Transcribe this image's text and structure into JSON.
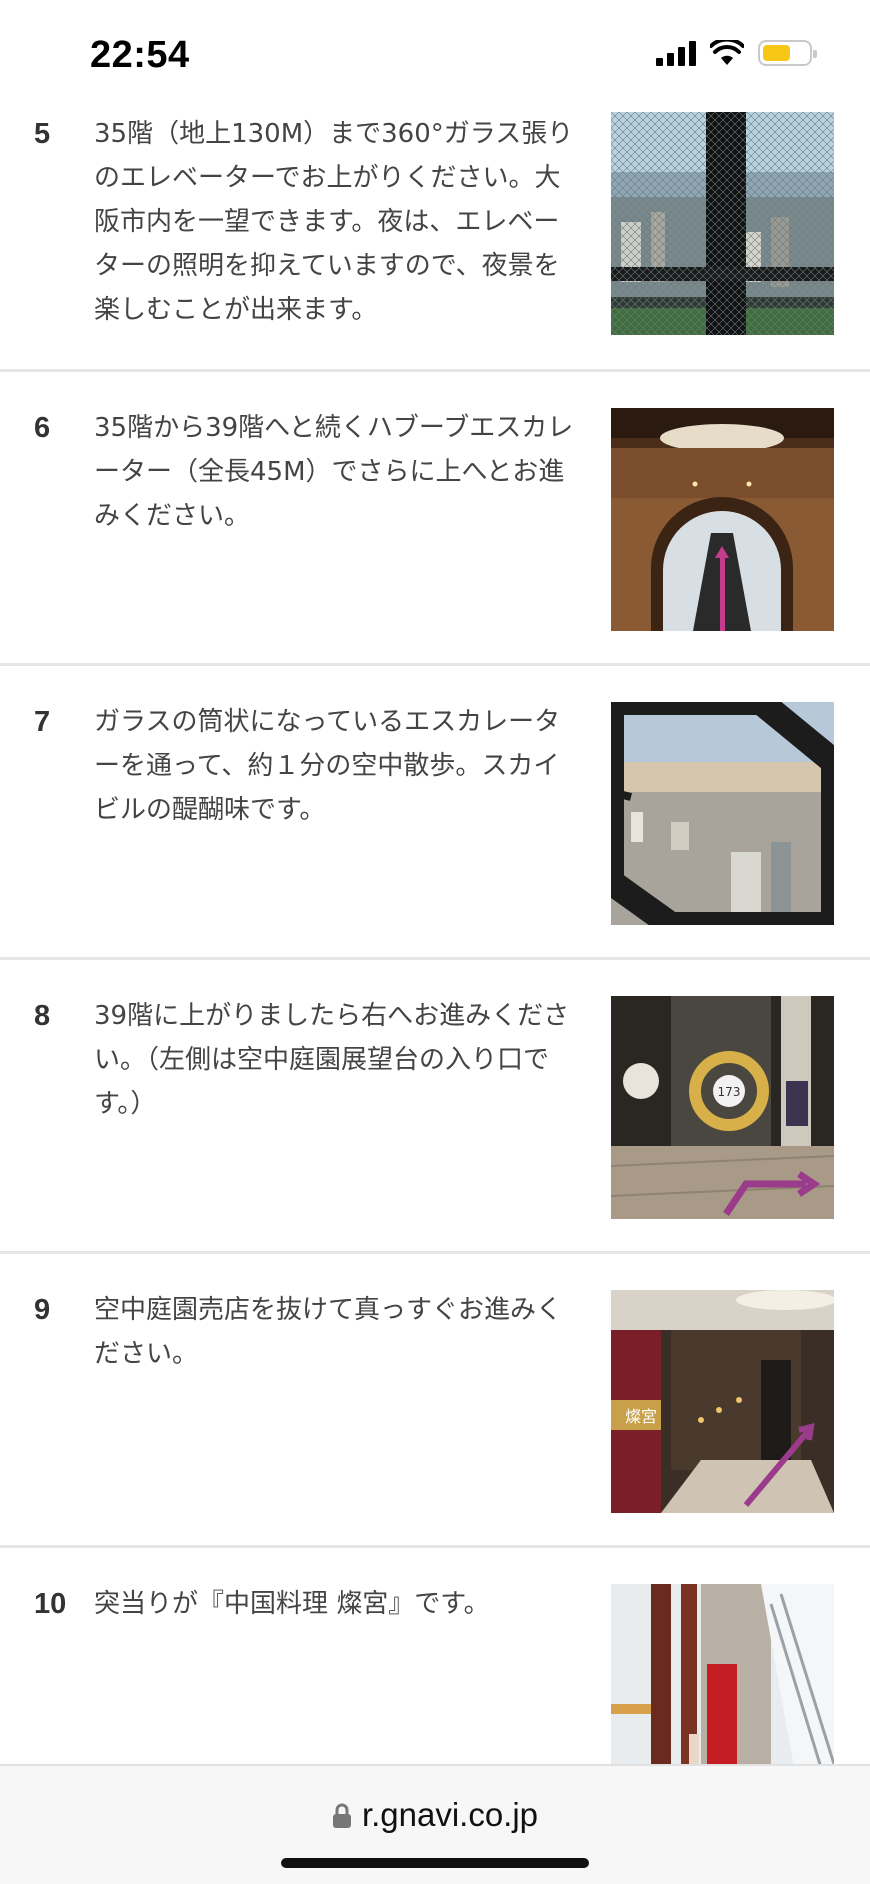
{
  "status": {
    "time": "22:54"
  },
  "steps": [
    {
      "num": "5",
      "text": "35階（地上130M）まで360°ガラス張りのエレベーターでお上がりください。大阪市内を一望できます。夜は、エレベーターの照明を抑えていますので、夜景を楽しむことが出来ます。"
    },
    {
      "num": "6",
      "text": "35階から39階へと続くハブーブエスカレーター（全長45M）でさらに上へとお進みください。"
    },
    {
      "num": "7",
      "text": "ガラスの筒状になっているエスカレーターを通って、約１分の空中散歩。スカイビルの醍醐味です。"
    },
    {
      "num": "8",
      "text": "39階に上がりましたら右へお進みください。（左側は空中庭園展望台の入り口です。）",
      "photo_label": "173"
    },
    {
      "num": "9",
      "text": "空中庭園売店を抜けて真っすぐお進みください。",
      "photo_label": "燦宮"
    },
    {
      "num": "10",
      "text": "突当りが『中国料理 燦宮』です。"
    }
  ],
  "browser": {
    "url": "r.gnavi.co.jp"
  },
  "colors": {
    "accent_arrow": "#b43c8c",
    "battery": "#f8c615"
  }
}
